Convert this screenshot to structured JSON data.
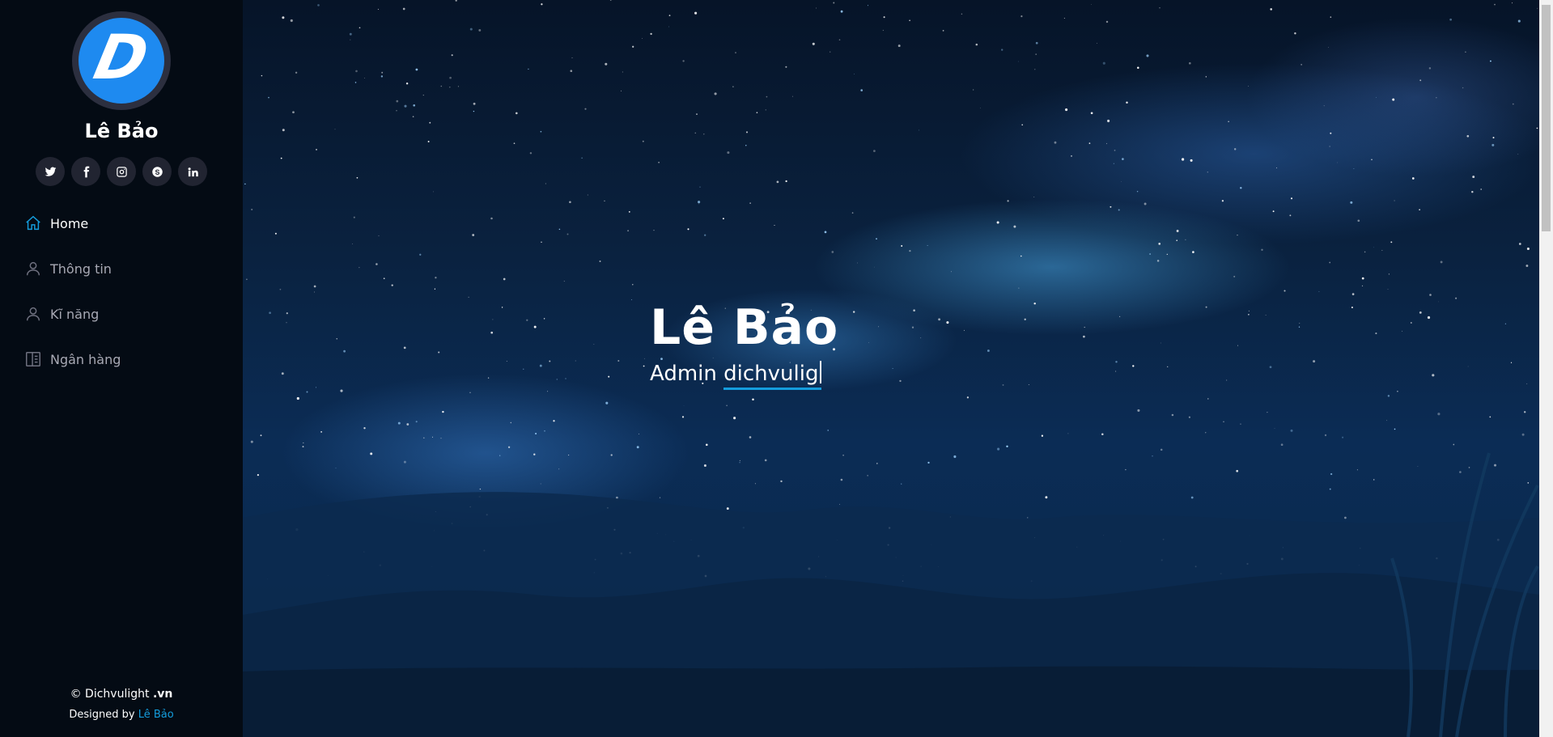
{
  "profile": {
    "name": "Lê Bảo",
    "avatar_mark": "D"
  },
  "social": [
    {
      "icon": "twitter-icon"
    },
    {
      "icon": "facebook-icon"
    },
    {
      "icon": "instagram-icon"
    },
    {
      "icon": "skype-icon"
    },
    {
      "icon": "linkedin-icon"
    }
  ],
  "nav": [
    {
      "label": "Home",
      "icon": "home-icon",
      "active": true
    },
    {
      "label": "Thông tin",
      "icon": "user-icon",
      "active": false
    },
    {
      "label": "Kĩ năng",
      "icon": "user-icon",
      "active": false
    },
    {
      "label": "Ngân hàng",
      "icon": "book-icon",
      "active": false
    }
  ],
  "footer": {
    "copy_prefix": "© Dichvulight",
    "copy_suffix": ".vn",
    "credits_prefix": "Designed by",
    "credits_link": "Lê Bảo"
  },
  "hero": {
    "title": "Lê Bảo",
    "sub_prefix": "Admin",
    "typed": "dichvulig"
  },
  "colors": {
    "accent": "#149ddd",
    "sidebar_bg": "#040b14",
    "avatar_bg": "#1e8af0"
  }
}
